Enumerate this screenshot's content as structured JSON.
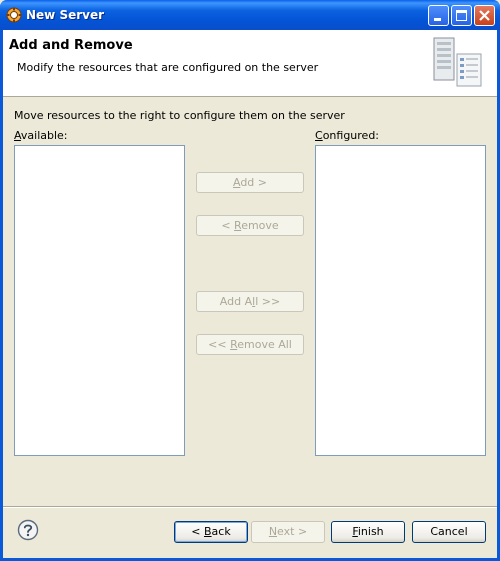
{
  "window": {
    "title": "New Server",
    "icon": "server-gear-icon",
    "controls": [
      "minimize-icon",
      "maximize-icon",
      "close-icon"
    ]
  },
  "header": {
    "title": "Add and Remove",
    "description": "Modify the resources that are configured on the server",
    "image": "server-list-icon"
  },
  "body": {
    "instruction": "Move resources to the right to configure them on the server",
    "available_label": {
      "mnemonic": "A",
      "rest": "vailable:"
    },
    "configured_label": {
      "mnemonic": "C",
      "rest": "onfigured:"
    },
    "available_items": [],
    "configured_items": []
  },
  "buttons": {
    "add": {
      "pre": "",
      "mnemonic": "A",
      "post": "dd >"
    },
    "remove": {
      "pre": "< ",
      "mnemonic": "R",
      "post": "emove"
    },
    "add_all": {
      "pre": "Add A",
      "mnemonic": "l",
      "post": "l >>"
    },
    "remove_all": {
      "pre": "<< ",
      "mnemonic": "R",
      "post": "emove All"
    }
  },
  "footer": {
    "help_icon": "help-icon",
    "back": {
      "pre": "< ",
      "mnemonic": "B",
      "post": "ack"
    },
    "next": {
      "pre": "",
      "mnemonic": "N",
      "post": "ext >"
    },
    "finish": {
      "pre": "",
      "mnemonic": "F",
      "post": "inish"
    },
    "cancel": {
      "label": "Cancel"
    }
  },
  "colors": {
    "titlebar": "#0453d6",
    "dialog_bg": "#ece9d8",
    "disabled_text": "#aca899"
  }
}
